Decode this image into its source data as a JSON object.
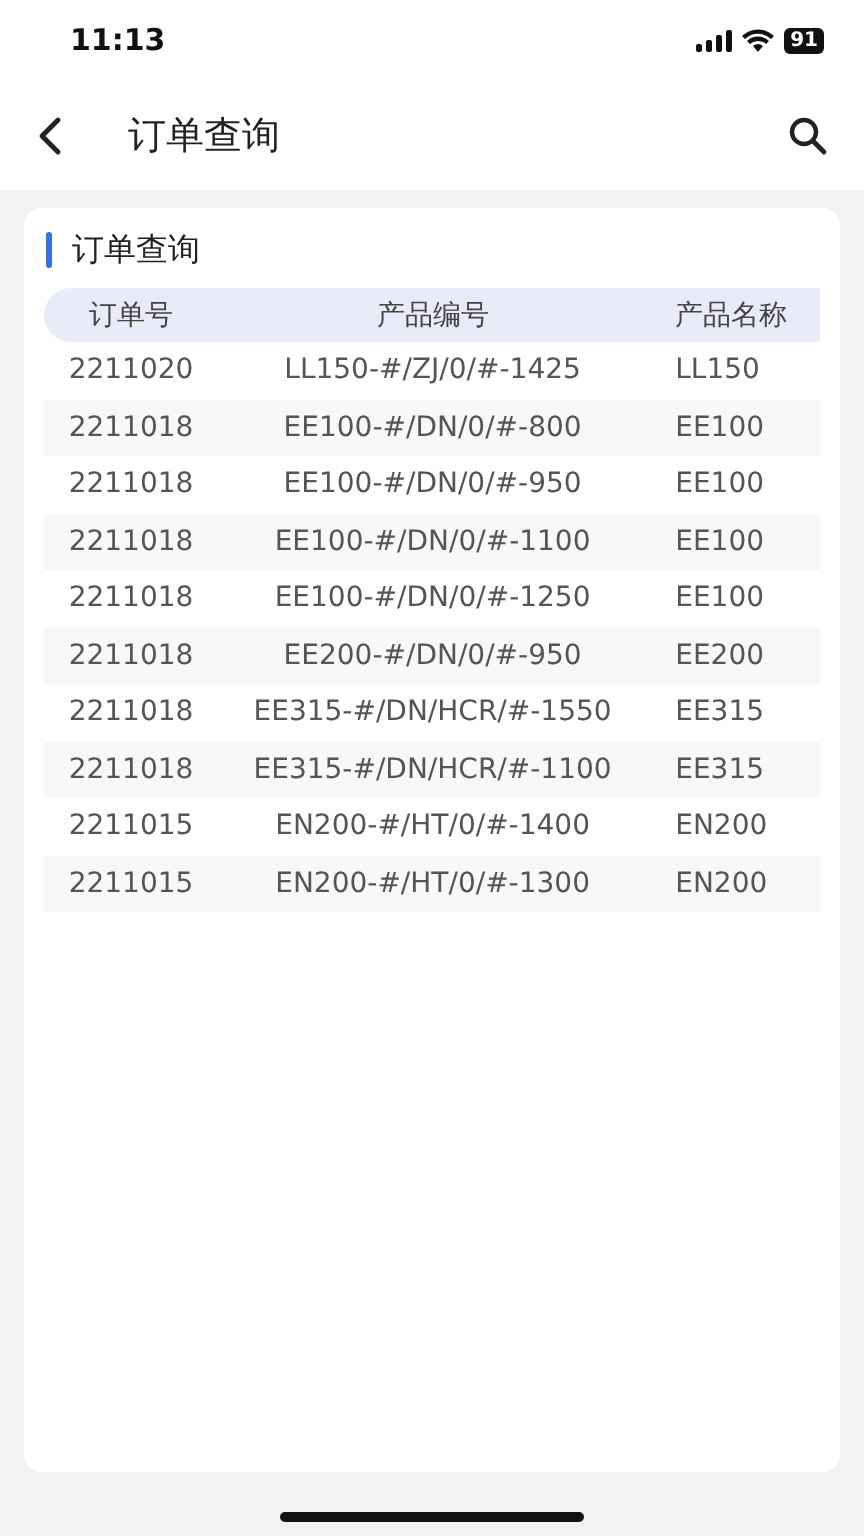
{
  "status_bar": {
    "time": "11:13",
    "battery": "91"
  },
  "nav": {
    "title": "订单查询"
  },
  "section": {
    "title": "订单查询"
  },
  "table": {
    "columns": [
      "订单号",
      "产品编号",
      "产品名称"
    ],
    "rows": [
      [
        "2211020",
        "LL150-#/ZJ/0/#-1425",
        "LL150"
      ],
      [
        "2211018",
        "EE100-#/DN/0/#-800",
        "EE100"
      ],
      [
        "2211018",
        "EE100-#/DN/0/#-950",
        "EE100"
      ],
      [
        "2211018",
        "EE100-#/DN/0/#-1100",
        "EE100"
      ],
      [
        "2211018",
        "EE100-#/DN/0/#-1250",
        "EE100"
      ],
      [
        "2211018",
        "EE200-#/DN/0/#-950",
        "EE200"
      ],
      [
        "2211018",
        "EE315-#/DN/HCR/#-1550",
        "EE315"
      ],
      [
        "2211018",
        "EE315-#/DN/HCR/#-1100",
        "EE315"
      ],
      [
        "2211015",
        "EN200-#/HT/0/#-1400",
        "EN200"
      ],
      [
        "2211015",
        "EN200-#/HT/0/#-1300",
        "EN200"
      ]
    ]
  }
}
